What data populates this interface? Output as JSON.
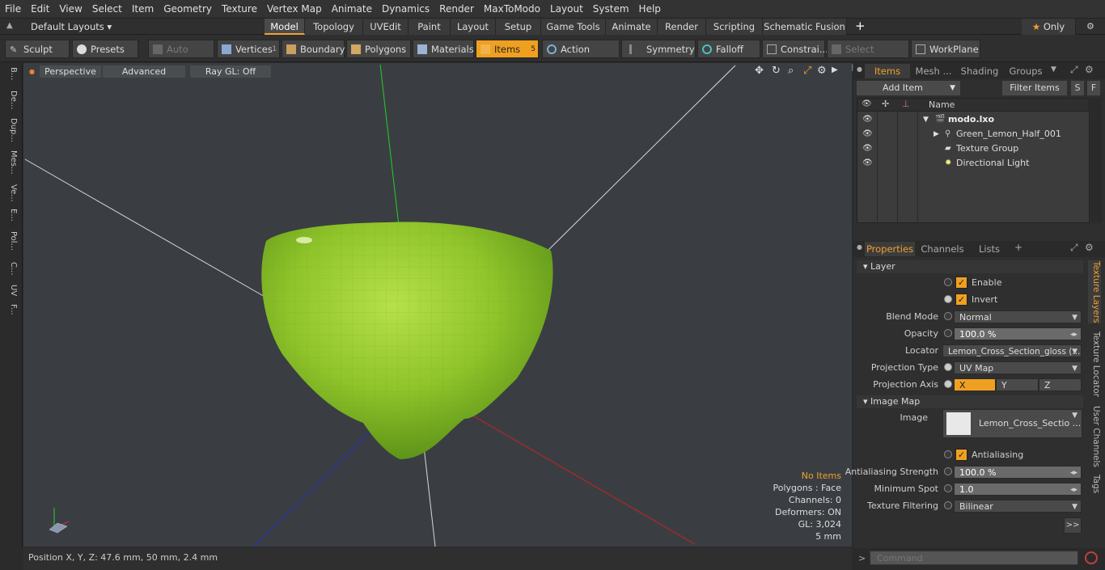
{
  "menu": [
    "File",
    "Edit",
    "View",
    "Select",
    "Item",
    "Geometry",
    "Texture",
    "Vertex Map",
    "Animate",
    "Dynamics",
    "Render",
    "MaxToModo",
    "Layout",
    "System",
    "Help"
  ],
  "layout_dropdown": "Default Layouts",
  "mode_tabs": [
    "Model",
    "Topology",
    "UVEdit",
    "Paint",
    "Layout",
    "Setup",
    "Game Tools",
    "Animate",
    "Render",
    "Scripting",
    "Schematic Fusion"
  ],
  "mode_active": "Model",
  "only_label": "Only",
  "toolbar": {
    "sculpt": "Sculpt",
    "presets": "Presets",
    "auto_select": "Auto Select",
    "vertices": "Vertices",
    "vertices_count": "1",
    "boundary": "Boundary",
    "polygons": "Polygons",
    "materials": "Materials",
    "items": "Items",
    "items_count": "5",
    "action_center": "Action Center",
    "symmetry": "Symmetry",
    "falloff": "Falloff",
    "constraints": "Constrai...",
    "select_through": "Select Through",
    "workplane": "WorkPlane"
  },
  "left_tabs": [
    "B...",
    "De...",
    "Dup...",
    "Mes...",
    "Ve...",
    "E...",
    "Pol...",
    "C...",
    "UV",
    "F..."
  ],
  "viewport": {
    "perspective": "Perspective",
    "advanced": "Advanced",
    "raygl": "Ray GL: Off",
    "info": {
      "no_items": "No Items",
      "polygons": "Polygons : Face",
      "channels": "Channels: 0",
      "deformers": "Deformers: ON",
      "gl": "GL: 3,024",
      "scale": "5 mm"
    },
    "accent_color": "#f0a030"
  },
  "status": "Position X, Y, Z:  47.6 mm, 50 mm, 2.4 mm",
  "items_panel": {
    "tabs": [
      "Items",
      "Mesh ...",
      "Shading",
      "Groups"
    ],
    "add_item": "Add Item",
    "filter_items": "Filter Items",
    "s_btn": "S",
    "f_btn": "F",
    "name_col": "Name",
    "tree": [
      "modo.lxo",
      "Green_Lemon_Half_001",
      "Texture Group",
      "Directional Light"
    ]
  },
  "properties": {
    "tabs": [
      "Properties",
      "Channels",
      "Lists"
    ],
    "layer_section": "Layer",
    "enable": "Enable",
    "invert": "Invert",
    "blend_mode_label": "Blend Mode",
    "blend_mode": "Normal",
    "opacity_label": "Opacity",
    "opacity": "100.0 %",
    "locator_label": "Locator",
    "locator": "Lemon_Cross_Section_gloss (...",
    "proj_type_label": "Projection Type",
    "proj_type": "UV Map",
    "proj_axis_label": "Projection Axis",
    "axis_x": "X",
    "axis_y": "Y",
    "axis_z": "Z",
    "image_map_section": "Image Map",
    "image_label": "Image",
    "image": "Lemon_Cross_Sectio ...",
    "antialiasing": "Antialiasing",
    "aa_strength_label": "Antialiasing Strength",
    "aa_strength": "100.0 %",
    "min_spot_label": "Minimum Spot",
    "min_spot": "1.0",
    "filtering_label": "Texture Filtering",
    "filtering": "Bilinear",
    "more": ">>",
    "side_tabs": [
      "Texture Layers",
      "Texture Locator",
      "User Channels",
      "Tags"
    ]
  },
  "command_placeholder": "Command"
}
